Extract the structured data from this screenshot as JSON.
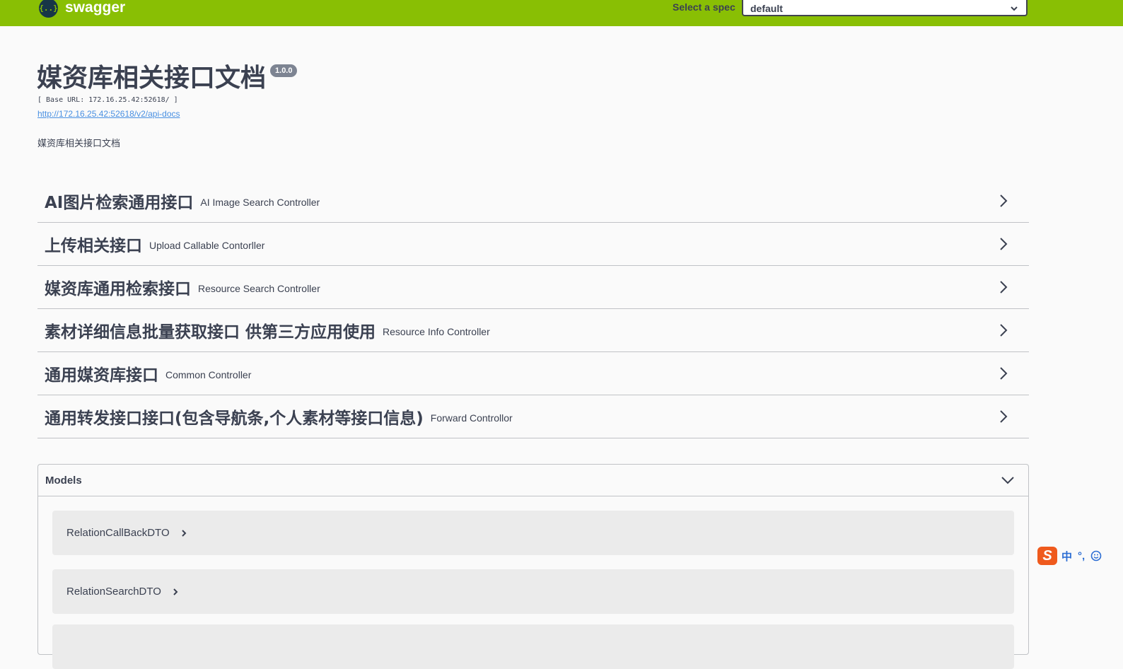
{
  "topbar": {
    "logo_mark": "{..}",
    "logo_text": "swagger",
    "spec_label": "Select a spec",
    "spec_value": "default"
  },
  "info": {
    "title": "媒资库相关接口文档",
    "version": "1.0.0",
    "base_url": "[ Base URL: 172.16.25.42:52618/ ]",
    "docs_link": "http://172.16.25.42:52618/v2/api-docs",
    "description": "媒资库相关接口文档"
  },
  "tags": [
    {
      "name": "AI图片检索通用接口",
      "description": "AI Image Search Controller"
    },
    {
      "name": "上传相关接口",
      "description": "Upload Callable Contorller"
    },
    {
      "name": "媒资库通用检索接口",
      "description": "Resource Search Controller"
    },
    {
      "name": "素材详细信息批量获取接口 供第三方应用使用",
      "description": "Resource Info Controller"
    },
    {
      "name": "通用媒资库接口",
      "description": "Common Controller"
    },
    {
      "name": "通用转发接口接口(包含导航条,个人素材等接口信息)",
      "description": "Forward Controllor"
    }
  ],
  "models": {
    "title": "Models",
    "items": [
      {
        "name": "RelationCallBackDTO"
      },
      {
        "name": "RelationSearchDTO"
      },
      {
        "name": ""
      }
    ]
  },
  "ime": {
    "logo": "S",
    "mode": "中",
    "punct": "°,"
  },
  "colors": {
    "topbar": "#89bf04",
    "text": "#3b4151",
    "link": "#4990e2",
    "model_bg": "#ebebeb"
  }
}
